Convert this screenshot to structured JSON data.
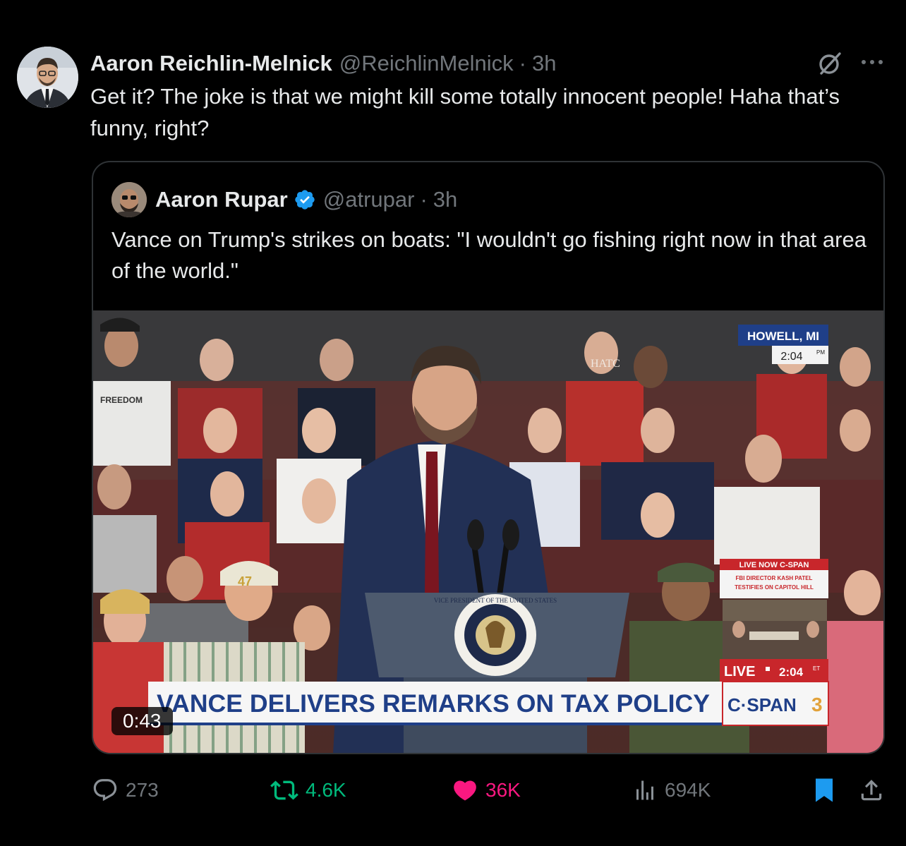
{
  "tweet": {
    "author_name": "Aaron Reichlin-Melnick",
    "handle": "@ReichlinMelnick",
    "meta_separator": "·",
    "time": "3h",
    "text": "Get it? The joke is that we might kill some totally innocent people! Haha that’s funny, right?"
  },
  "quote": {
    "author_name": "Aaron Rupar",
    "handle": "@atrupar",
    "meta_separator": "·",
    "time": "3h",
    "verified": true,
    "text": "Vance on Trump's strikes on boats: \"I wouldn't go fishing right now in that area of the world.\"",
    "video": {
      "duration": "0:43",
      "location_line1": "HOWELL, MI",
      "location_time": "2:04",
      "location_time_suffix": "PM",
      "live_now": "LIVE NOW C-SPAN",
      "live_now_sub1": "FBI DIRECTOR KASH PATEL",
      "live_now_sub2": "TESTIFIES ON CAPITOL HILL",
      "live_label": "LIVE",
      "live_time": "2:04",
      "live_time_suffix": "ET",
      "lower_third": "VANCE DELIVERS REMARKS ON TAX POLICY",
      "network_name": "C·SPAN",
      "network_number": "3",
      "shirt_text": "FREEDOM",
      "cap_text": "47",
      "seal_text": "VICE PRESIDENT OF THE UNITED STATES",
      "sign_text": "HATC"
    }
  },
  "actions": {
    "replies": "273",
    "reposts": "4.6K",
    "likes": "36K",
    "views": "694K"
  },
  "colors": {
    "background": "#000000",
    "text_primary": "#e7e9ea",
    "text_secondary": "#71767b",
    "verified_blue": "#1d9bf0",
    "repost_green": "#00ba7c",
    "like_pink": "#f91880",
    "bookmark_blue": "#1d9bf0"
  }
}
